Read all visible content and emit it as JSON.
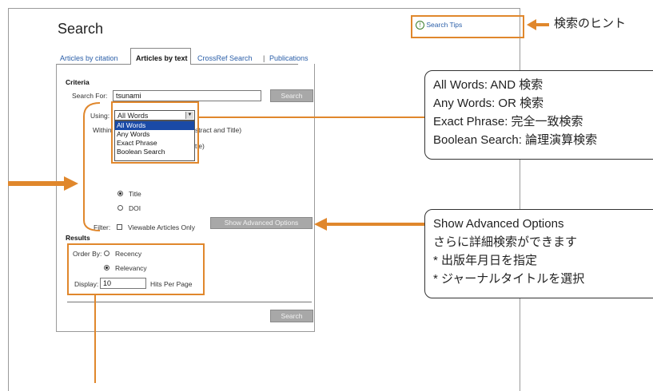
{
  "page": {
    "title": "Search"
  },
  "tabs": [
    {
      "label": "Articles by citation"
    },
    {
      "label": "Articles by text"
    },
    {
      "label": "CrossRef Search"
    },
    {
      "label": "|"
    },
    {
      "label": "Publications"
    }
  ],
  "search_tips": {
    "label": "Search Tips",
    "annotation": "検索のヒント"
  },
  "criteria": {
    "heading": "Criteria",
    "search_for_label": "Search For:",
    "search_for_value": "tsunami",
    "search_button": "Search",
    "using_label": "Using:",
    "using_value": "All Words",
    "using_options": [
      "All Words",
      "Any Words",
      "Exact Phrase",
      "Boolean Search"
    ],
    "within_label": "Within:",
    "within_partial_1": "stract and Title)",
    "within_partial_2": "tle)",
    "within_option_title": "Title",
    "within_option_doi": "DOI",
    "filter_label": "Filter:",
    "filter_option": "Viewable Articles Only",
    "advanced_button": "Show Advanced Options"
  },
  "results": {
    "heading": "Results",
    "order_by_label": "Order By:",
    "order_recency": "Recency",
    "order_relevancy": "Relevancy",
    "display_label": "Display:",
    "display_value": "10",
    "display_suffix": "Hits Per Page",
    "search_button": "Search"
  },
  "callouts": {
    "using": [
      "All Words: AND 検索",
      "Any Words: OR 検索",
      "Exact Phrase: 完全一致検索",
      "Boolean Search: 論理演算検索"
    ],
    "advanced": [
      "Show Advanced Options",
      "さらに詳細検索ができます",
      "* 出版年月日を指定",
      "* ジャーナルタイトルを選択"
    ]
  },
  "colors": {
    "accent_orange": "#e0872c",
    "link_blue": "#2a5ea8",
    "selected_blue": "#1a4aa6",
    "button_gray": "#a8a8a8"
  }
}
